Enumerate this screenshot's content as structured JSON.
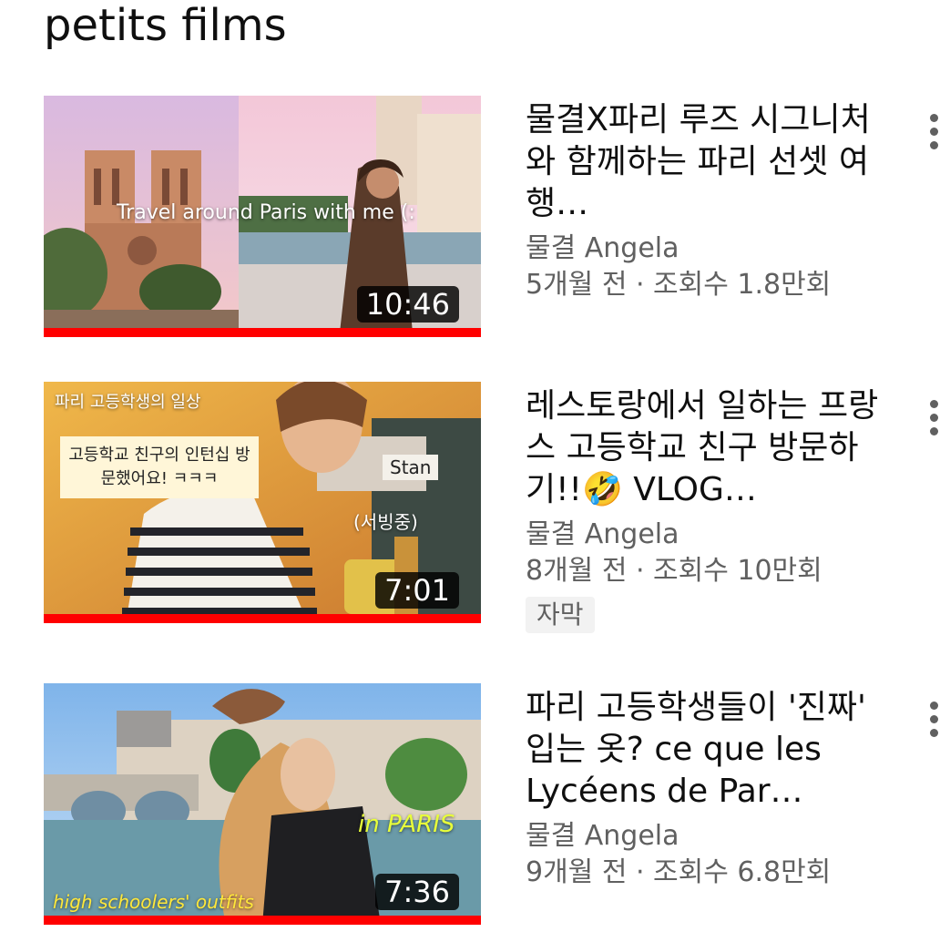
{
  "section": {
    "title": "petits films"
  },
  "colors": {
    "accent": "#ff0000",
    "secondary_text": "#606060"
  },
  "videos": [
    {
      "thumb_caption": "Travel around Paris with me (:",
      "duration": "10:46",
      "watched_fraction": 1.0,
      "title": "물결X파리 루즈 시그니처와 함께하는 파리 선셋 여행…",
      "channel": "물결 Angela",
      "meta": "5개월 전 · 조회수 1.8만회",
      "badge": ""
    },
    {
      "thumb_caption_top": "파리 고등학생의 일상",
      "thumb_caption_box": "고등학교 친구의 인턴십 방문했어요! ㅋㅋㅋ",
      "thumb_label_stan": "Stan",
      "thumb_label_serving": "(서빙중)",
      "duration": "7:01",
      "watched_fraction": 1.0,
      "title": "레스토랑에서 일하는 프랑스 고등학교 친구 방문하기!!🤣 VLOG…",
      "channel": "물결 Angela",
      "meta": "8개월 전 · 조회수 10만회",
      "badge": "자막"
    },
    {
      "thumb_caption_right": "in PARIS",
      "thumb_caption_bottom": "high schoolers' outfits",
      "duration": "7:36",
      "watched_fraction": 1.0,
      "title": "파리 고등학생들이 '진짜' 입는 옷? ce que les Lycéens de Par…",
      "channel": "물결 Angela",
      "meta": "9개월 전 · 조회수 6.8만회",
      "badge": ""
    }
  ]
}
